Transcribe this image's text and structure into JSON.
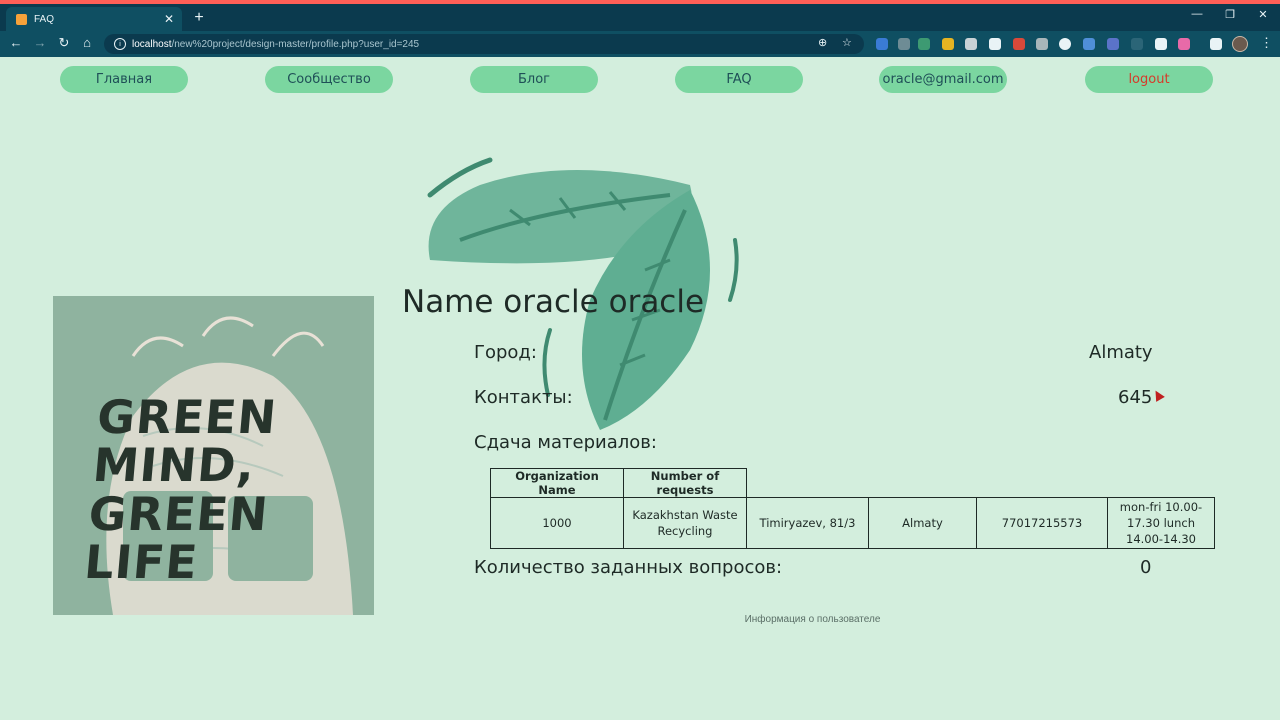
{
  "browser": {
    "tab_title": "FAQ",
    "new_tab": "+",
    "tab_close": "✕",
    "url_host": "localhost",
    "url_path": "/new%20project/design-master/profile.php?user_id=245",
    "win_minimize": "—",
    "win_restore": "❐",
    "win_close": "✕",
    "accent": "#0f4f62"
  },
  "nav": {
    "items": [
      {
        "label": "Главная"
      },
      {
        "label": "Сообщество"
      },
      {
        "label": "Блог"
      },
      {
        "label": "FAQ"
      },
      {
        "label": "oracle@gmail.com"
      },
      {
        "label": "logout"
      }
    ]
  },
  "photo": {
    "line1": "GREEN MIND,",
    "line2": "GREEN LIFE"
  },
  "profile": {
    "name": "Name oracle oracle",
    "city_label": "Город:",
    "city_value": "Almaty",
    "contacts_label": "Контакты:",
    "contacts_value": "645",
    "materials_label": "Сдача материалов:",
    "questions_label": "Количество заданных вопросов:",
    "questions_value": "0"
  },
  "table": {
    "headers": [
      "Organization Name",
      "Number of requests"
    ],
    "row": [
      "1000",
      "Kazakhstan Waste Recycling",
      "Timiryazev, 81/3",
      "Almaty",
      "77017215573",
      "mon-fri 10.00-17.30 lunch 14.00-14.30"
    ]
  },
  "footer": {
    "text": "Информация о пользователе"
  },
  "colors": {
    "page_bg": "#d3eedd",
    "pill": "#7bd6a0",
    "logout": "#d63a2a",
    "leaf": "#5fae92"
  }
}
